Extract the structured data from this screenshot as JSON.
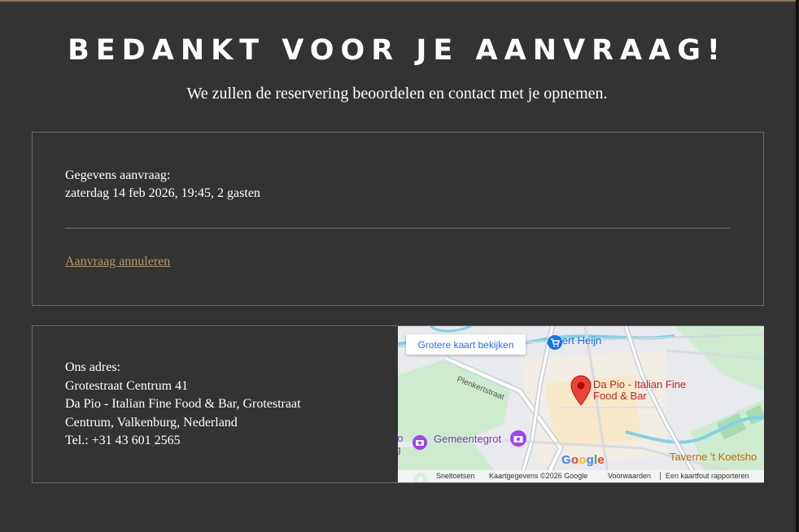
{
  "confirmation": {
    "heading": "BEDANKT VOOR JE AANVRAAG!",
    "subheading": "We zullen de reservering beoordelen en contact met je opnemen."
  },
  "request": {
    "label": "Gegevens aanvraag:",
    "details": "zaterdag 14 feb 2026, 19:45, 2 gasten",
    "cancel_link": "Aanvraag annuleren"
  },
  "address": {
    "label": "Ons adres:",
    "street": "Grotestraat Centrum 41",
    "full_line1": "Da Pio - Italian Fine Food & Bar, Grotestraat",
    "full_line2": "Centrum, Valkenburg, Nederland",
    "phone": "Tel.: +31 43 601 2565"
  },
  "map": {
    "larger_map_button": "Grotere kaart bekijken",
    "labels": {
      "store": "Albert Heijn",
      "street": "Plenkertstraat",
      "restaurant": "Da Pio - Italian Fine Food & Bar",
      "attraction": "Gemeentegrot",
      "attraction_left_top": "ho",
      "attraction_left_bottom": "rg",
      "tavern": "Taverne 't Koetsho"
    },
    "logo_letters": [
      "G",
      "o",
      "o",
      "g",
      "l",
      "e"
    ],
    "footer": {
      "shortcuts": "Sneltoetsen",
      "map_data": "Kaartgegevens ©2026 Google",
      "terms": "Voorwaarden",
      "report": "Een kaartfout rapporteren"
    },
    "icons": [
      "shopping-cart-icon",
      "location-pin-icon",
      "camera-icon",
      "tree-icon"
    ]
  },
  "colors": {
    "background": "#333333",
    "accent_link": "#b09a6e",
    "border": "#6a6a6a",
    "pin": "#ea4335"
  }
}
